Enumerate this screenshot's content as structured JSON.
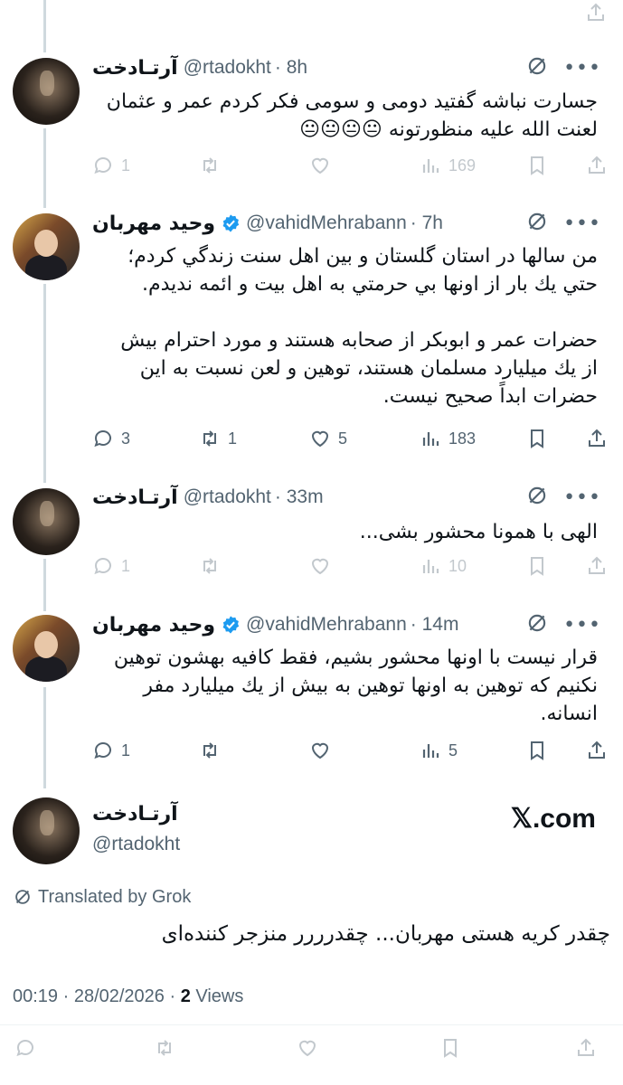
{
  "tweets": [
    {
      "name": "آرتـادخت",
      "handle": "@rtadokht",
      "time": "· 8h",
      "text": "جسارت نباشه گفتید دومی و سومی فکر کردم عمر و عثمان\nلعنت الله علیه منظورتونه 😐😐😐😐",
      "reply": "1",
      "retweet": "",
      "like": "",
      "views": "169"
    },
    {
      "name": "وحید مهربان",
      "handle": "@vahidMehrabann",
      "time": "· 7h",
      "text": "من سالها در استان گلستان و بين اهل سنت زندگي كردم؛\nحتي يك بار از اونها بي حرمتي به اهل بيت و ائمه نديدم.\n\nحضرات عمر و ابوبكر از صحابه هستند و مورد احترام بيش\nاز يك ميليارد مسلمان هستند، توهين و لعن نسبت به اين\nحضرات ابداً صحيح نيست.",
      "reply": "3",
      "retweet": "1",
      "like": "5",
      "views": "183"
    },
    {
      "name": "آرتـادخت",
      "handle": "@rtadokht",
      "time": "· 33m",
      "text": "الهی با همونا محشور بشی...",
      "reply": "1",
      "retweet": "",
      "like": "",
      "views": "10"
    },
    {
      "name": "وحید مهربان",
      "handle": "@vahidMehrabann",
      "time": "· 14m",
      "text": "قرار نيست با اونها محشور بشيم، فقط كافيه بهشون توهين\nنكنيم كه توهين به اونها توهين به بيش از يك ميليارد مفر\nانسانه.",
      "reply": "1",
      "retweet": "",
      "like": "",
      "views": "5"
    }
  ],
  "main": {
    "name": "آرتـادخت",
    "handle": "@rtadokht",
    "brand": "𝕏.com",
    "translated": "Translated by Grok",
    "text": "چقدر کریه هستی مهربان... چقدرررر منزجر کننده‌ای",
    "timestamp": "00:19 · 28/02/2026 · ",
    "views_count": "2",
    "views_label": " Views"
  },
  "colors": {
    "verified": "#1d9bf0",
    "muted": "#536471",
    "line": "#cfd9de"
  }
}
